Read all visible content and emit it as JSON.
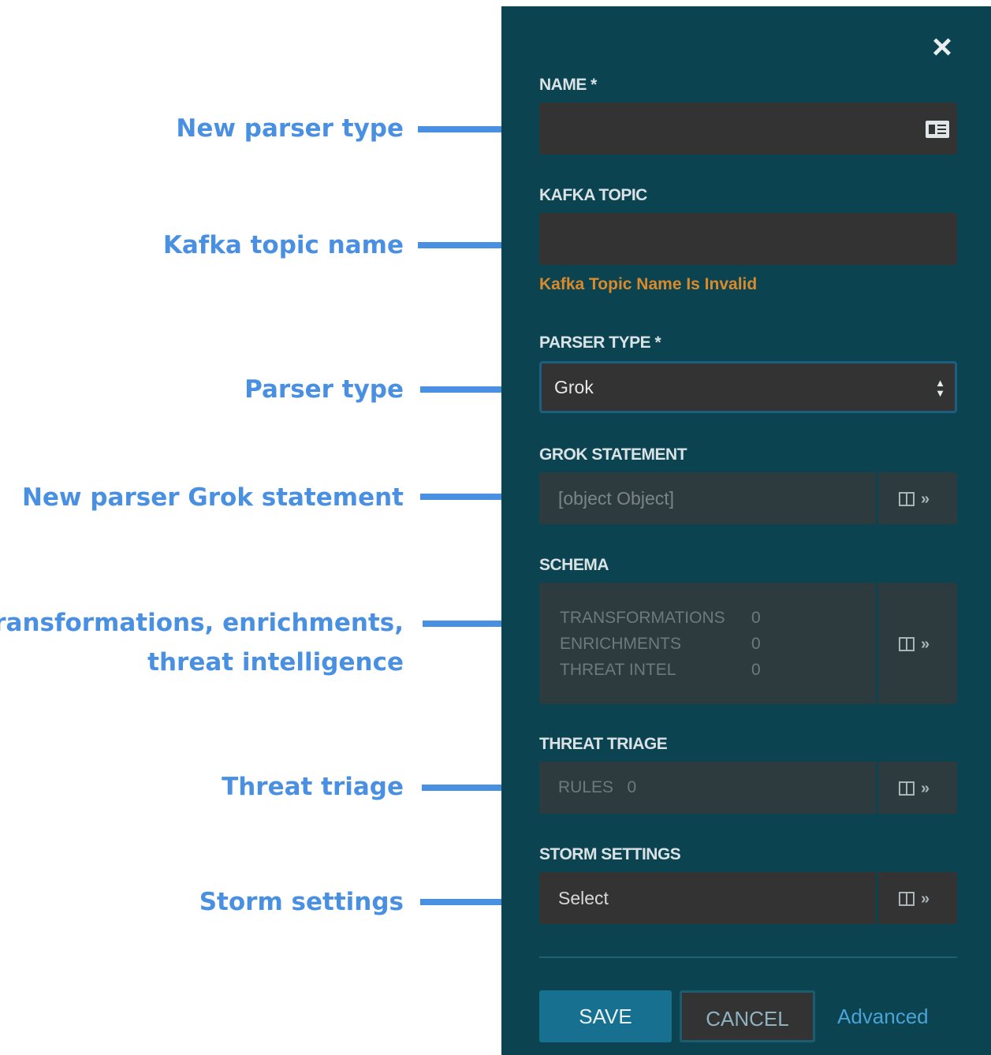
{
  "annotations": [
    {
      "text": [
        "New parser type"
      ]
    },
    {
      "text": [
        "Kafka topic name"
      ]
    },
    {
      "text": [
        "Parser type"
      ]
    },
    {
      "text": [
        "New parser Grok statement"
      ]
    },
    {
      "text": [
        "Transformations, enrichments,",
        "threat intelligence"
      ]
    },
    {
      "text": [
        "Threat triage"
      ]
    },
    {
      "text": [
        "Storm settings"
      ]
    }
  ],
  "panel": {
    "close_icon": "×",
    "name": {
      "label": "NAME *",
      "value": "",
      "icon": "contact-card-icon"
    },
    "kafka_topic": {
      "label": "KAFKA TOPIC",
      "value": "",
      "error": "Kafka Topic Name Is Invalid"
    },
    "parser_type": {
      "label": "PARSER TYPE *",
      "value": "Grok"
    },
    "grok_statement": {
      "label": "GROK STATEMENT",
      "value": "[object Object]"
    },
    "schema": {
      "label": "SCHEMA",
      "rows": [
        {
          "key": "TRANSFORMATIONS",
          "value": "0"
        },
        {
          "key": "ENRICHMENTS",
          "value": "0"
        },
        {
          "key": "THREAT INTEL",
          "value": "0"
        }
      ]
    },
    "threat_triage": {
      "label": "THREAT TRIAGE",
      "rules_key": "RULES",
      "rules_value": "0"
    },
    "storm_settings": {
      "label": "STORM SETTINGS",
      "value": "Select"
    },
    "buttons": {
      "save": "SAVE",
      "cancel": "CANCEL",
      "advanced": "Advanced"
    },
    "colors": {
      "panel_bg": "#0c4350",
      "annotation": "#4a90e2",
      "error": "#d98a2b",
      "save": "#17708f"
    }
  }
}
